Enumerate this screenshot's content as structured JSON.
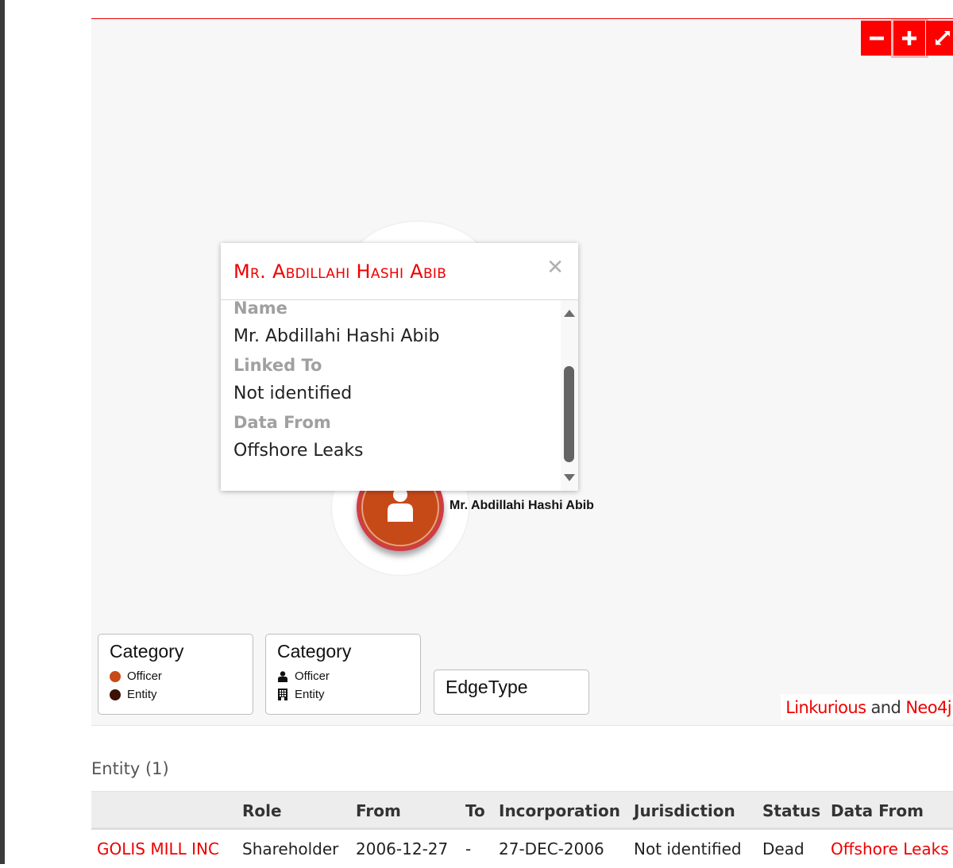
{
  "graph": {
    "zoom_controls": {
      "zoom_out_icon": "minus-icon",
      "zoom_in_icon": "plus-icon",
      "fullscreen_icon": "expand-icon"
    },
    "node": {
      "label": "Mr. Abdillahi Hashi Abib",
      "icon": "user-icon",
      "color": "#c64a18"
    },
    "legends": [
      {
        "title": "Category",
        "items": [
          {
            "label": "Officer",
            "color": "#c64a18"
          },
          {
            "label": "Entity",
            "color": "#3d1105"
          }
        ]
      },
      {
        "title": "Category",
        "items": [
          {
            "label": "Officer",
            "icon": "user-icon"
          },
          {
            "label": "Entity",
            "icon": "building-icon"
          }
        ]
      },
      {
        "title": "EdgeType",
        "items": []
      }
    ],
    "credits": {
      "link1": "Linkurious",
      "and": " and ",
      "link2": "Neo4j"
    }
  },
  "popup": {
    "title": "Mr. Abdillahi Hashi Abib",
    "close_icon": "close-icon",
    "fields": [
      {
        "label": "Name",
        "value": "Mr. Abdillahi Hashi Abib"
      },
      {
        "label": "Linked To",
        "value": "Not identified"
      },
      {
        "label": "Data From",
        "value": "Offshore Leaks"
      }
    ]
  },
  "entity_section": {
    "title": "Entity (1)",
    "columns": [
      "",
      "Role",
      "From",
      "To",
      "Incorporation",
      "Jurisdiction",
      "Status",
      "Data From"
    ],
    "rows": [
      [
        "GOLIS MILL INC",
        "Shareholder",
        "2006-12-27",
        "-",
        "27-DEC-2006",
        "Not identified",
        "Dead",
        "Offshore Leaks"
      ]
    ]
  },
  "colors": {
    "accent": "#ee0000",
    "officer": "#c64a18",
    "entity": "#3d1105"
  }
}
